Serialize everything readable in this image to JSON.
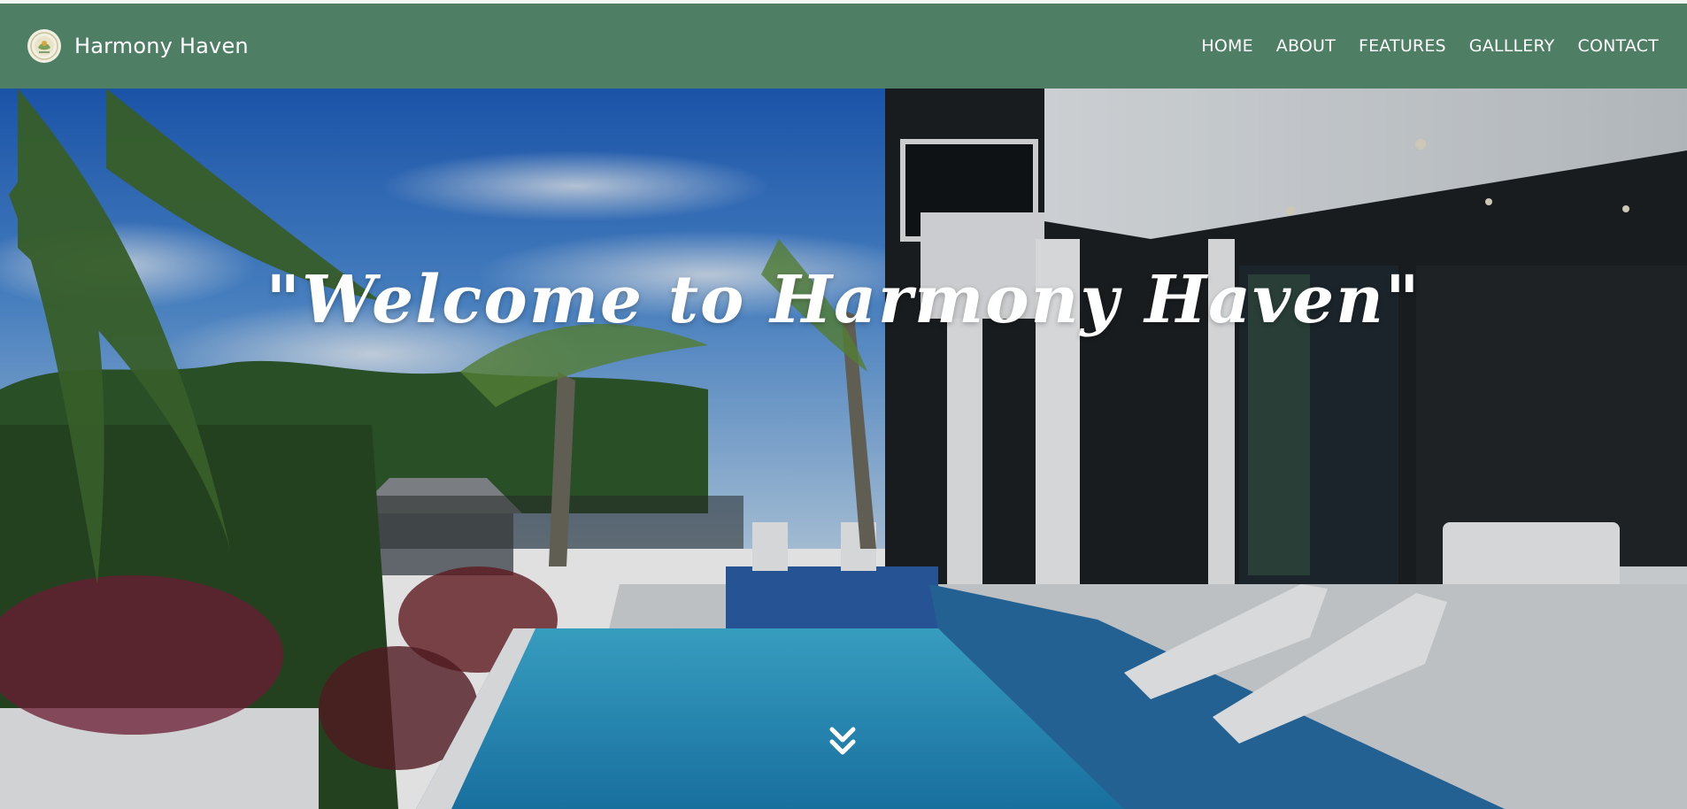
{
  "header": {
    "brand_name": "Harmony Haven",
    "logo_icon": "leaf-emblem-icon",
    "nav_items": [
      {
        "label": "HOME"
      },
      {
        "label": "ABOUT"
      },
      {
        "label": "FEATURES"
      },
      {
        "label": "GALLLERY"
      },
      {
        "label": "CONTACT"
      }
    ]
  },
  "hero": {
    "title": "\"Welcome to Harmony Haven\"",
    "scroll_icon": "double-chevron-down-icon"
  },
  "colors": {
    "navbar_bg": "#4e7f65",
    "nav_text": "#ffffff",
    "hero_title": "#ffffff"
  }
}
